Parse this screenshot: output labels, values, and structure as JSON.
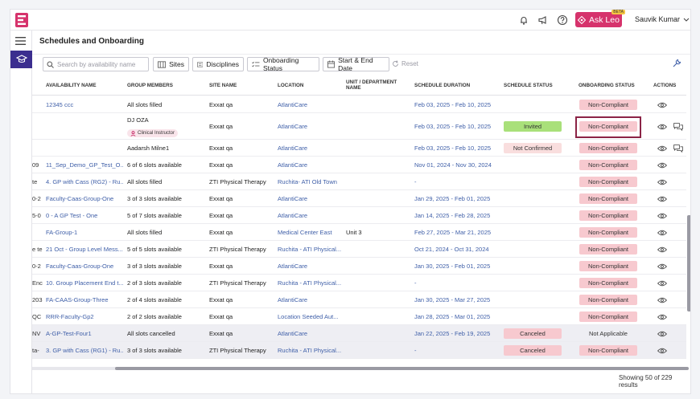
{
  "header": {
    "ask_leo_label": "Ask Leo",
    "ask_leo_badge": "BETA",
    "user_name": "Sauvik Kumar"
  },
  "page": {
    "title": "Schedules and Onboarding"
  },
  "toolbar": {
    "search_placeholder": "Search by availability name",
    "sites_label": "Sites",
    "disciplines_label": "Disciplines",
    "onboarding_status_label": "Onboarding Status",
    "date_label": "Start & End Date",
    "reset_label": "Reset"
  },
  "table": {
    "columns": {
      "availability": "AVAILABILITY NAME",
      "group": "GROUP MEMBERS",
      "site": "SITE NAME",
      "location": "LOCATION",
      "unit": "UNIT / DEPARTMENT NAME",
      "duration": "SCHEDULE DURATION",
      "schedule_status": "SCHEDULE STATUS",
      "onboarding_status": "ONBOARDING STATUS",
      "actions": "ACTIONS"
    },
    "rows": [
      {
        "prefix": "",
        "name": "12345 ccc",
        "group": "All slots filled",
        "site": "Exxat qa",
        "location": "AtlantiCare",
        "unit": "",
        "duration": "Feb 03, 2025 - Feb 10, 2025",
        "status": "",
        "onboarding": "Non-Compliant"
      },
      {
        "prefix": "",
        "name": "",
        "group": "DJ OZA",
        "role": "Clinical Instructor",
        "site": "Exxat qa",
        "location": "AtlantiCare",
        "unit": "",
        "duration": "Feb 03, 2025 - Feb 10, 2025",
        "status": "Invited",
        "onboarding": "Non-Compliant"
      },
      {
        "prefix": "",
        "name": "",
        "group": "Aadarsh Milne1",
        "site": "Exxat qa",
        "location": "AtlantiCare",
        "unit": "",
        "duration": "Feb 03, 2025 - Feb 10, 2025",
        "status": "Not Confirmed",
        "onboarding": "Non-Compliant"
      },
      {
        "prefix": "09",
        "name": "11_Sep_Demo_GP_Test_O...",
        "group": "6 of 6 slots available",
        "site": "Exxat qa",
        "location": "AtlantiCare",
        "unit": "",
        "duration": "Nov 01, 2024 - Nov 30, 2024",
        "status": "",
        "onboarding": "Non-Compliant"
      },
      {
        "prefix": "te",
        "name": "4. GP with Cass (RG2) - Ru...",
        "group": "All slots filled",
        "site": "ZTI Physical Therapy",
        "location": "Ruchita- ATI Old Town",
        "unit": "",
        "duration": "-",
        "status": "",
        "onboarding": "Non-Compliant"
      },
      {
        "prefix": "0-2",
        "name": "Faculty-Caas-Group-One",
        "group": "3 of 3 slots available",
        "site": "Exxat qa",
        "location": "AtlantiCare",
        "unit": "",
        "duration": "Jan 29, 2025 - Feb 01, 2025",
        "status": "",
        "onboarding": "Non-Compliant"
      },
      {
        "prefix": "5-0",
        "name": "0 - A GP Test - One",
        "group": "5 of 7 slots available",
        "site": "Exxat qa",
        "location": "AtlantiCare",
        "unit": "",
        "duration": "Jan 14, 2025 - Feb 28, 2025",
        "status": "",
        "onboarding": "Non-Compliant"
      },
      {
        "prefix": "",
        "name": "FA-Group-1",
        "group": "All slots filled",
        "site": "Exxat qa",
        "location": "Medical Center East",
        "unit": "Unit 3",
        "duration": "Feb 27, 2025 - Mar 21, 2025",
        "status": "",
        "onboarding": "Non-Compliant"
      },
      {
        "prefix": "e te",
        "name": "21 Oct - Group Level Mess...",
        "group": "5 of 5 slots available",
        "site": "ZTI Physical Therapy",
        "location": "Ruchita - ATI Physical...",
        "unit": "",
        "duration": "Oct 21, 2024 - Oct 31, 2024",
        "status": "",
        "onboarding": "Non-Compliant"
      },
      {
        "prefix": "0-2",
        "name": "Faculty-Caas-Group-One",
        "group": "3 of 3 slots available",
        "site": "Exxat qa",
        "location": "AtlantiCare",
        "unit": "",
        "duration": "Jan 30, 2025 - Feb 01, 2025",
        "status": "",
        "onboarding": "Non-Compliant"
      },
      {
        "prefix": "Enc",
        "name": "10. Group Placement End t...",
        "group": "2 of 3 slots available",
        "site": "ZTI Physical Therapy",
        "location": "Ruchita - ATI Physical...",
        "unit": "",
        "duration": "-",
        "status": "",
        "onboarding": "Non-Compliant"
      },
      {
        "prefix": "203",
        "name": "FA-CAAS-Group-Three",
        "group": "2 of 4 slots available",
        "site": "Exxat qa",
        "location": "AtlantiCare",
        "unit": "",
        "duration": "Jan 30, 2025 - Mar 27, 2025",
        "status": "",
        "onboarding": "Non-Compliant"
      },
      {
        "prefix": "QC",
        "name": "RRR-Faculty-Gp2",
        "group": "2 of 2 slots available",
        "site": "Exxat qa",
        "location": "Location Seeded Aut...",
        "unit": "",
        "duration": "Jan 28, 2025 - Mar 01, 2025",
        "status": "",
        "onboarding": "Non-Compliant"
      },
      {
        "prefix": "NV",
        "name": "A-GP-Test-Four1",
        "group": "All slots cancelled",
        "site": "Exxat qa",
        "location": "AtlantiCare",
        "unit": "",
        "duration": "Jan 22, 2025 - Feb 19, 2025",
        "status": "Canceled",
        "onboarding": "Not Applicable"
      },
      {
        "prefix": "ta-",
        "name": "3. GP with Cass (RG1) - Ru...",
        "group": "3 of 3 slots available",
        "site": "ZTI Physical Therapy",
        "location": "Ruchita - ATI Physical...",
        "unit": "",
        "duration": "-",
        "status": "Canceled",
        "onboarding": "Non-Compliant"
      }
    ]
  },
  "footer": {
    "results": "Showing 50 of 229 results"
  },
  "colors": {
    "accent": "#d6336c",
    "sidebar_active": "#3b2e8f",
    "link": "#3f5fa8",
    "non_compliant_bg": "#f7c9cf",
    "invited_bg": "#a9e07a"
  }
}
